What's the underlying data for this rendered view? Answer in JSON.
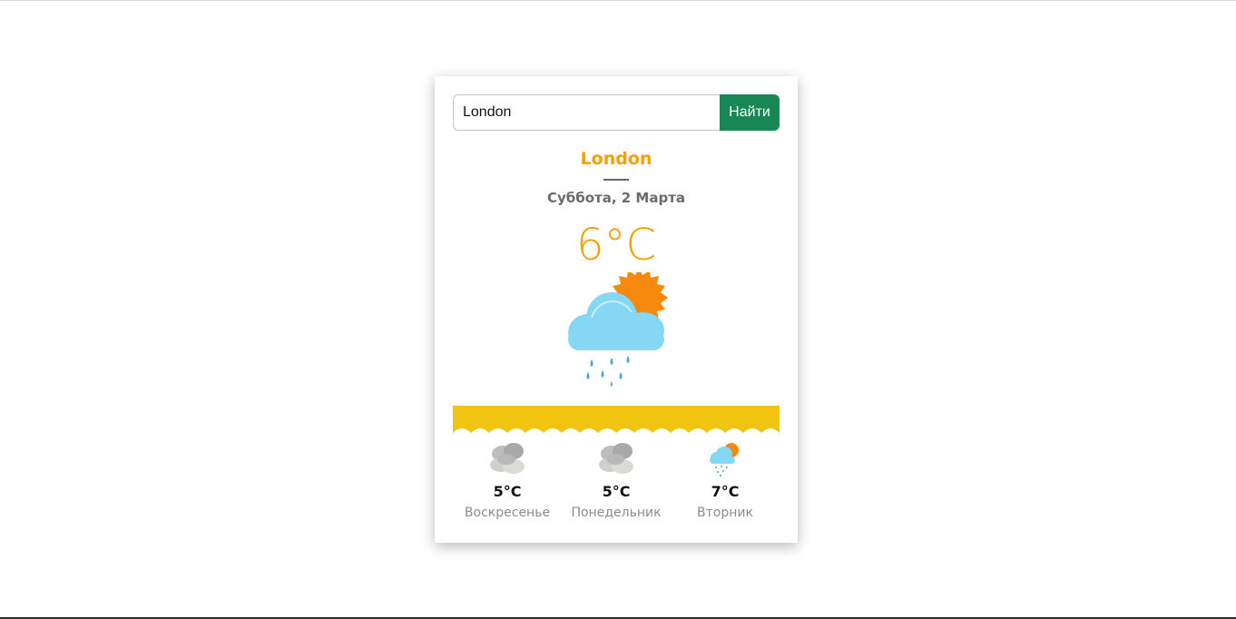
{
  "search": {
    "value": "London",
    "button_label": "Найти"
  },
  "current": {
    "city": "London",
    "date": "Суббота, 2 Марта",
    "temperature": "6°C",
    "icon": "sun-cloud-rain-icon"
  },
  "forecast": [
    {
      "temperature": "5°C",
      "day": "Воскресенье",
      "icon": "cloudy-icon"
    },
    {
      "temperature": "5°C",
      "day": "Понедельник",
      "icon": "cloudy-icon"
    },
    {
      "temperature": "7°C",
      "day": "Вторник",
      "icon": "sun-cloud-rain-icon"
    }
  ],
  "colors": {
    "accent": "#f4a000",
    "button": "#198754",
    "wave": "#f1c40f",
    "cloud": "#86d7f3",
    "sun": "#f7890c"
  }
}
